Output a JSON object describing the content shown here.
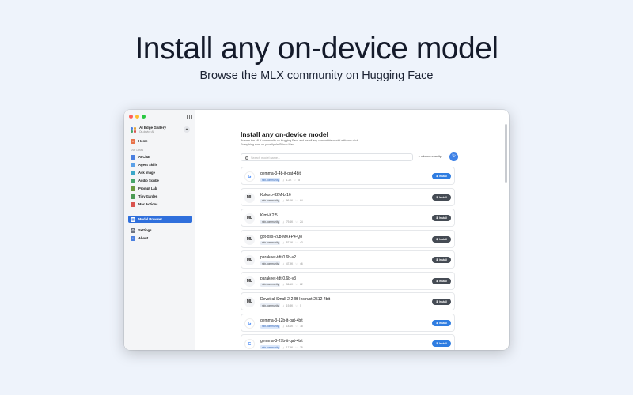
{
  "hero": {
    "title": "Install any on-device model",
    "subtitle": "Browse the MLX community on Hugging Face"
  },
  "sidebar": {
    "app_name": "AI Edge Gallery",
    "app_sub": "On-device AI",
    "home": "Home",
    "section_label": "Use Cases",
    "items": [
      {
        "label": "AI Chat",
        "icon": "chat-icon",
        "color": "#4a7fe0"
      },
      {
        "label": "Agent Skills",
        "icon": "skills-icon",
        "color": "#5aa0e8"
      },
      {
        "label": "Ask Image",
        "icon": "image-icon",
        "color": "#3ba7c9"
      },
      {
        "label": "Audio Scribe",
        "icon": "audio-icon",
        "color": "#47a56b"
      },
      {
        "label": "Prompt Lab",
        "icon": "lab-icon",
        "color": "#6a9a3f"
      },
      {
        "label": "Tiny Garden",
        "icon": "garden-icon",
        "color": "#4c9a55"
      },
      {
        "label": "Mac Actions",
        "icon": "actions-icon",
        "color": "#d9534f"
      }
    ],
    "model_browser": "Model Browser",
    "settings": "Settings",
    "about": "About"
  },
  "main": {
    "title": "Install any on-device model",
    "desc_line1": "Browse the MLX community on Hugging Face and install any compatible model with one click.",
    "desc_line2": "Everything runs on your Apple Silicon Mac.",
    "search_placeholder": "Search model name...",
    "filter_label": "mlx-community",
    "install_label": "⬇ Install",
    "models": [
      {
        "name": "gemma-3-4b-it-qat-4bit",
        "logo": "G",
        "tag": "mlx-community",
        "tag_style": "blue",
        "dl": "1.2K",
        "likes": "8",
        "btn": "blue"
      },
      {
        "name": "Kokoro-82M-bf16",
        "logo": "ML",
        "tag": "mlx-community",
        "tag_style": "gray",
        "dl": "96.6K",
        "likes": "64",
        "btn": "dark"
      },
      {
        "name": "Kimi-K2.5",
        "logo": "ML",
        "tag": "mlx-community",
        "tag_style": "gray",
        "dl": "79.4K",
        "likes": "24",
        "btn": "dark"
      },
      {
        "name": "gpt-oss-20b-MXFP4-Q8",
        "logo": "ML",
        "tag": "mlx-community",
        "tag_style": "gray",
        "dl": "57.1K",
        "likes": "43",
        "btn": "dark"
      },
      {
        "name": "parakeet-tdt-0.6b-v2",
        "logo": "ML",
        "tag": "mlx-community",
        "tag_style": "gray",
        "dl": "47.9K",
        "likes": "46",
        "btn": "dark"
      },
      {
        "name": "parakeet-tdt-0.6b-v3",
        "logo": "ML",
        "tag": "mlx-community",
        "tag_style": "gray",
        "dl": "36.1K",
        "likes": "22",
        "btn": "dark"
      },
      {
        "name": "Devstral-Small-2-24B-Instruct-2512-4bit",
        "logo": "ML",
        "tag": "mlx-community",
        "tag_style": "gray",
        "dl": "19.8K",
        "likes": "5",
        "btn": "dark"
      },
      {
        "name": "gemma-3-12b-it-qat-4bit",
        "logo": "G",
        "tag": "mlx-community",
        "tag_style": "blue",
        "dl": "18.1K",
        "likes": "18",
        "btn": "blue"
      },
      {
        "name": "gemma-3-27b-it-qat-4bit",
        "logo": "G",
        "tag": "mlx-community",
        "tag_style": "blue",
        "dl": "17.9K",
        "likes": "35",
        "btn": "blue"
      }
    ]
  }
}
